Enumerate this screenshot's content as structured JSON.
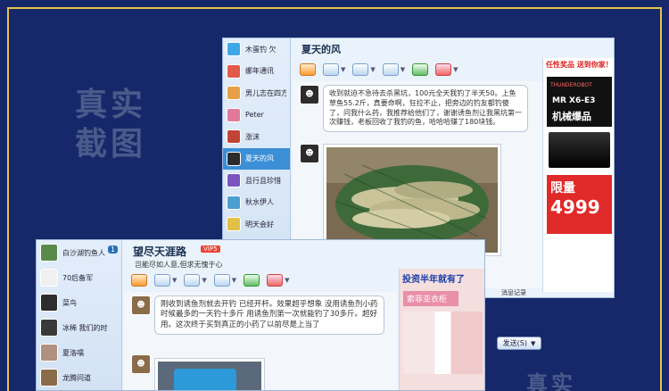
{
  "stamp_text": "真实截图",
  "stamp_bottom_text": "真实",
  "window1": {
    "title": "夏天的风",
    "contacts": [
      {
        "name": "木蛋钓 欠",
        "color": "#3fa7e5"
      },
      {
        "name": "娜年通讯",
        "color": "#e35a4a"
      },
      {
        "name": "男儿志在四方",
        "color": "#e7a048"
      },
      {
        "name": "Peter",
        "color": "#e17a9a"
      },
      {
        "name": "涨沫",
        "color": "#c24338"
      },
      {
        "name": "夏天的风",
        "color": "#2c2c2c"
      },
      {
        "name": "且行且珍惜",
        "color": "#7a55c0"
      },
      {
        "name": "秋水伊人",
        "color": "#4c9dd0"
      },
      {
        "name": "明天会好",
        "color": "#e3c046"
      },
      {
        "name": "",
        "color": "#9ab"
      }
    ],
    "message": "收到就迫不急待去杀黑坑，100元全天我钓了半天50。上鱼草鱼55.2斤，真要命啊，狂拉不止，把旁边的钓友都钓傻了，问我什么药，我推荐给他们了，谢谢诱鱼剂让我黑坑第一次赚钱，老板回收了我钓的鱼，哈哈哈赚了180块钱。",
    "history_label": "消息记录",
    "ad": {
      "banner": "任性奖品 送到你家！",
      "brand": "THUNDEROBOT",
      "model": "MR X6-E3",
      "slogan": "机械爆品",
      "price_label": "限量",
      "price": "4999"
    }
  },
  "window2": {
    "title": "望尽天涯路",
    "vip": "VIP5",
    "status": "岂能尽如人意,但求无愧于心",
    "contacts": [
      {
        "name": "白沙湖钓鱼人",
        "color": "#5a8a4a"
      },
      {
        "name": "70后备军",
        "color": "#f0f0f0"
      },
      {
        "name": "菜鸟",
        "color": "#2d2d2d"
      },
      {
        "name": "冰稀 我们的时",
        "color": "#3a3a3a"
      },
      {
        "name": "夏洛嚅",
        "color": "#b09080"
      },
      {
        "name": "龙腾问道",
        "color": "#8a6b4a"
      }
    ],
    "badge": "1",
    "message": "刚收到诱鱼剂就去开钓 已经开杆。效果超乎想象 没用诱鱼剂小药时候最多的一天钓十多斤 用诱鱼剂第一次就能钓了30多斤。超好用。这次终于买到真正的小药了以前尽是上当了",
    "ad_banner": "投资半年就有了",
    "ad_sub": "索菲亚衣柜",
    "send_label": "发送(S)"
  }
}
